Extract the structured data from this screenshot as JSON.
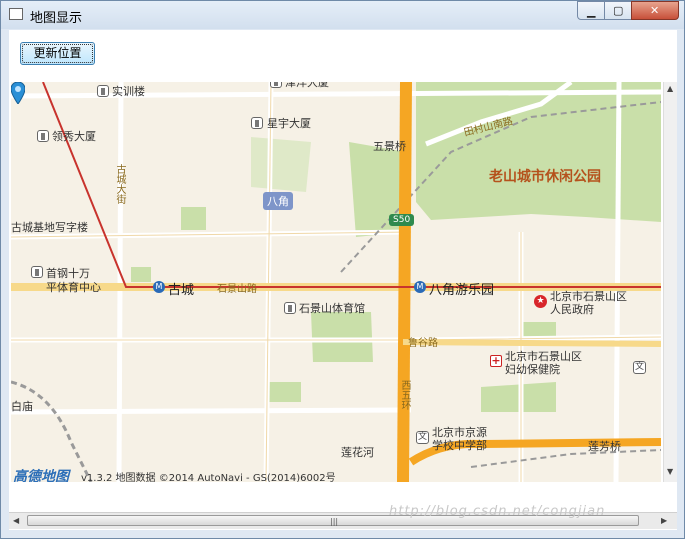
{
  "window": {
    "title": "地图显示"
  },
  "toolbar": {
    "update_label": "更新位置"
  },
  "map": {
    "labels": {
      "shishi": "实训楼",
      "jinyang": "津洋大厦",
      "lingxiu": "领秀大厦",
      "xingyu": "星宇大厦",
      "wujingqiao": "五景桥",
      "tiancun": "田村山南路",
      "park": "老山城市休闲公园",
      "gucheng_dajie": "古城大街",
      "gucheng_base": "古城基地写字楼",
      "bajiao": "八角",
      "s50": "S50",
      "shougang": "首钢十万",
      "shougang2": "平体育中心",
      "gucheng": "古城",
      "shijingshan_rd": "石景山路",
      "bajiao_park": "八角游乐园",
      "gov1": "北京市石景山区",
      "gov2": "人民政府",
      "stadium": "石景山体育馆",
      "luguolu": "鲁谷路",
      "hosp1": "北京市石景山区",
      "hosp2": "妇幼保健院",
      "xiwuhuan": "西五环",
      "baimiao": "白庙",
      "school1": "北京市京源",
      "school2": "学校中学部",
      "lianhuahe": "莲花河",
      "lianfangqiao": "莲芳桥"
    },
    "logo": "高德地图",
    "copyright": "v1.3.2 地图数据 ©2014 AutoNavi - GS(2014)6002号"
  },
  "watermark": "http://blog.csdn.net/congjian",
  "colors": {
    "road_main": "#f5a623",
    "metro_line": "#c8332d",
    "park": "#c9dfa9",
    "background": "#f6f1e6"
  },
  "icons": [
    "minimize-icon",
    "maximize-icon",
    "close-icon",
    "location-marker-icon",
    "metro-icon",
    "government-icon",
    "hospital-icon",
    "school-icon",
    "building-icon"
  ]
}
